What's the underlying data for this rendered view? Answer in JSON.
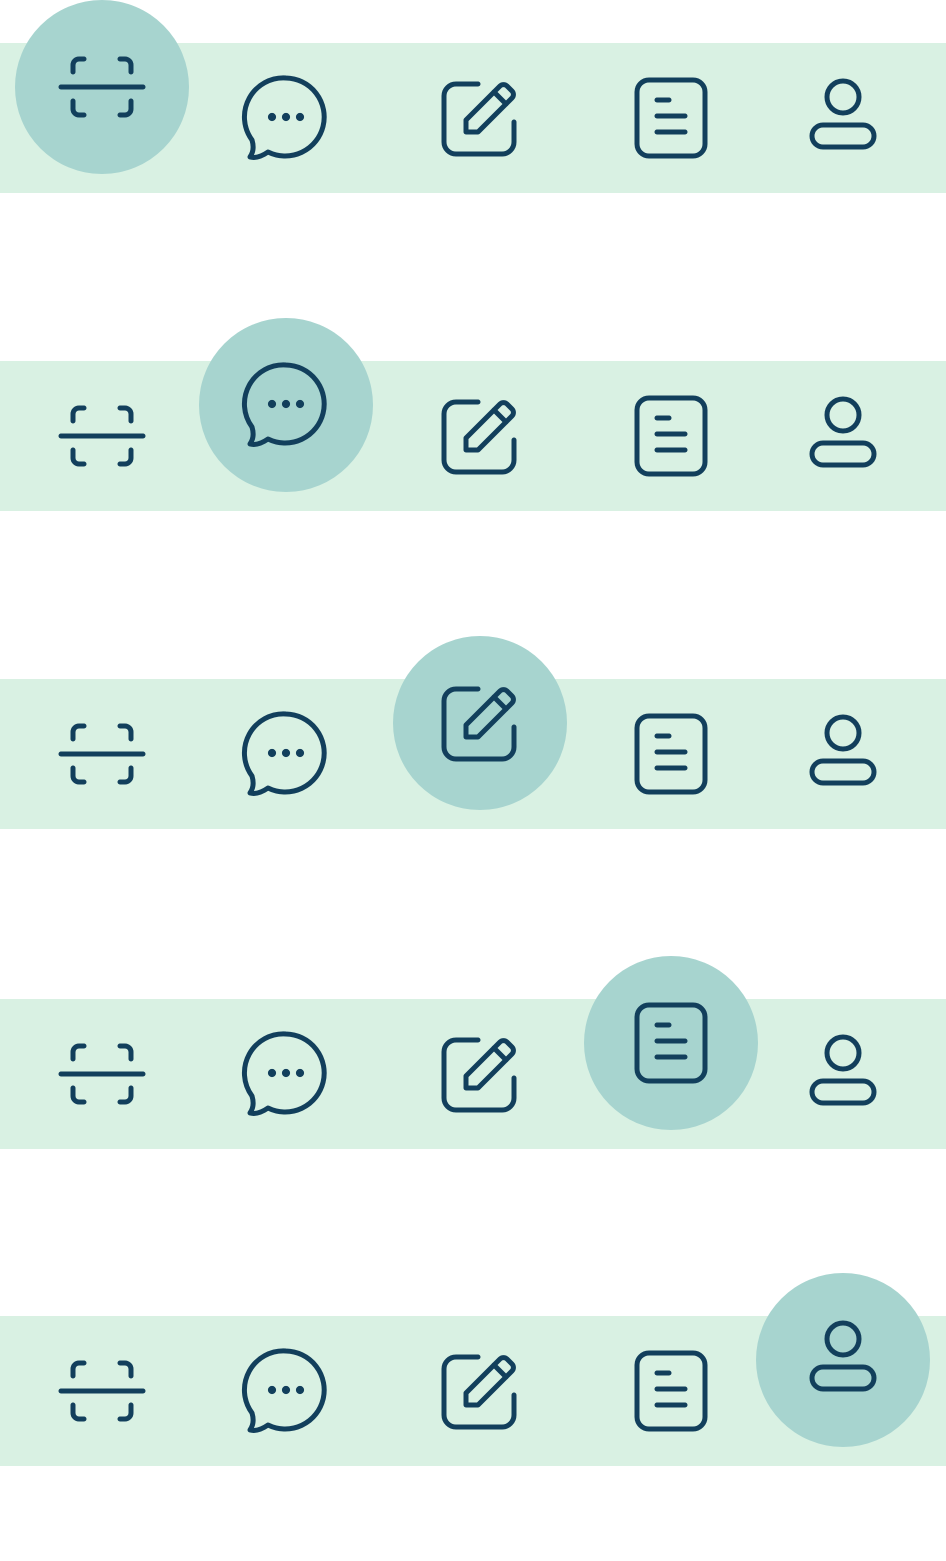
{
  "theme": {
    "bar_background": "#d9f1e3",
    "active_bubble": "#a7d4cf",
    "icon_stroke": "#123f5c",
    "page_background": "#ffffff"
  },
  "icons": [
    {
      "id": "scan",
      "icon": "scan-icon"
    },
    {
      "id": "chat",
      "icon": "chat-bubble-icon"
    },
    {
      "id": "edit",
      "icon": "edit-pencil-icon"
    },
    {
      "id": "document",
      "icon": "document-icon"
    },
    {
      "id": "profile",
      "icon": "user-icon"
    }
  ],
  "navbars": [
    {
      "state": "scan-selected",
      "active": "scan"
    },
    {
      "state": "chat-selected",
      "active": "chat"
    },
    {
      "state": "edit-selected",
      "active": "edit"
    },
    {
      "state": "document-selected",
      "active": "document"
    },
    {
      "state": "profile-selected",
      "active": "profile"
    }
  ]
}
